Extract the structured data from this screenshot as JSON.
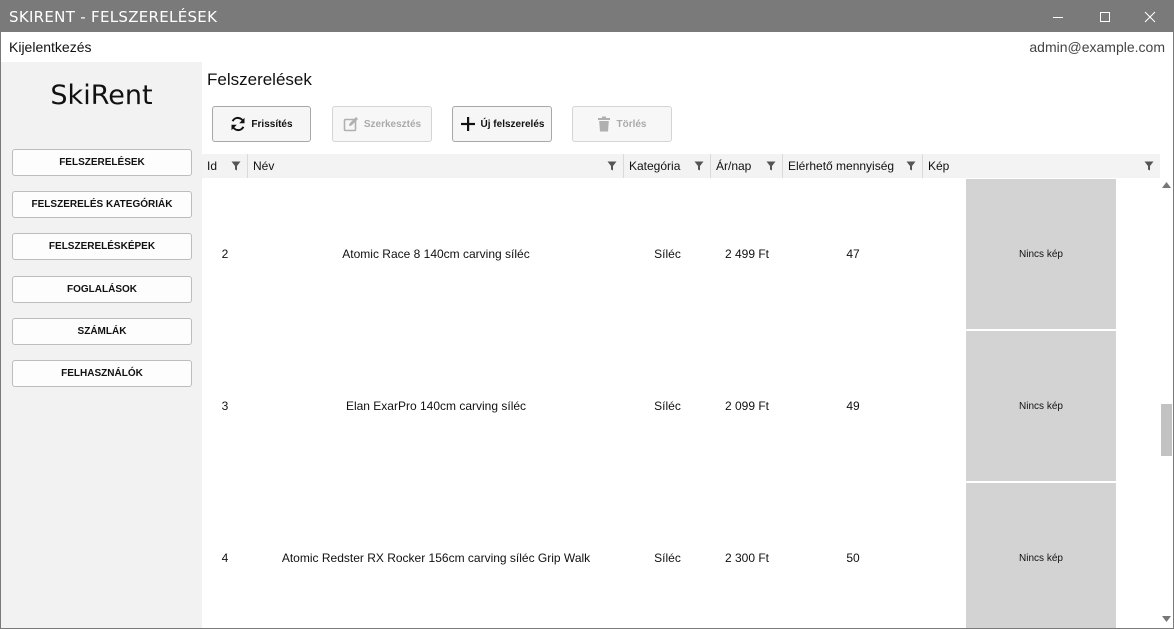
{
  "window": {
    "title": "SKIRENT - FELSZERELÉSEK"
  },
  "menubar": {
    "logout_label": "Kijelentkezés",
    "user_email": "admin@example.com"
  },
  "sidebar": {
    "brand": "SkiRent",
    "items": [
      {
        "label": "FELSZERELÉSEK"
      },
      {
        "label": "FELSZERELÉS KATEGÓRIÁK"
      },
      {
        "label": "FELSZERELÉSKÉPEK"
      },
      {
        "label": "FOGLALÁSOK"
      },
      {
        "label": "SZÁMLÁK"
      },
      {
        "label": "FELHASZNÁLÓK"
      }
    ]
  },
  "main": {
    "title": "Felszerelések",
    "toolbar": {
      "refresh_label": "Frissítés",
      "edit_label": "Szerkesztés",
      "new_label": "Új felszerelés",
      "delete_label": "Törlés"
    },
    "table": {
      "columns": [
        "Id",
        "Név",
        "Kategória",
        "Ár/nap",
        "Elérhető mennyiség",
        "Kép"
      ],
      "rows": [
        {
          "id": "2",
          "name": "Atomic Race 8 140cm carving síléc",
          "category": "Síléc",
          "price": "2 499 Ft",
          "quantity": "47",
          "image": "Nincs kép"
        },
        {
          "id": "3",
          "name": "Elan ExarPro 140cm carving síléc",
          "category": "Síléc",
          "price": "2 099 Ft",
          "quantity": "49",
          "image": "Nincs kép"
        },
        {
          "id": "4",
          "name": "Atomic Redster RX Rocker 156cm carving síléc Grip Walk",
          "category": "Síléc",
          "price": "2 300 Ft",
          "quantity": "50",
          "image": "Nincs kép"
        }
      ]
    }
  },
  "colors": {
    "titlebar": "#7a7a7a",
    "sidebar_bg": "#f2f2f2",
    "image_placeholder": "#d3d3d3"
  }
}
